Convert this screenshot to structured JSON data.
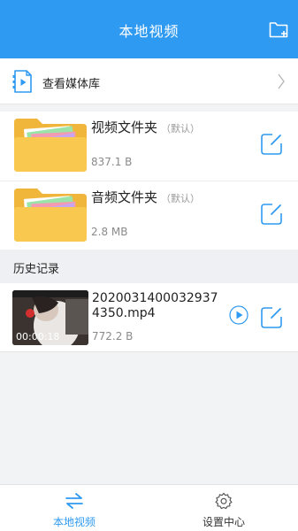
{
  "header": {
    "title": "本地视频",
    "add_folder_icon": "folder-add-icon"
  },
  "media_library": {
    "label": "查看媒体库",
    "icon": "media-file-icon",
    "chevron_icon": "chevron-right-icon"
  },
  "folders": [
    {
      "name": "视频文件夹",
      "default_tag": "（默认）",
      "size": "837.1 B"
    },
    {
      "name": "音频文件夹",
      "default_tag": "（默认）",
      "size": "2.8 MB"
    }
  ],
  "history": {
    "title": "历史记录",
    "items": [
      {
        "filename": "20200314000329374350.mp4",
        "size": "772.2 B",
        "duration": "00:00:18"
      }
    ]
  },
  "bottom_nav": {
    "items": [
      {
        "label": "本地视频",
        "icon": "swap-arrows-icon",
        "active": true
      },
      {
        "label": "设置中心",
        "icon": "gear-icon",
        "active": false
      }
    ]
  },
  "colors": {
    "accent": "#2f9af1",
    "folder_yellow": "#f9c84e",
    "inactive_text": "#333333"
  }
}
